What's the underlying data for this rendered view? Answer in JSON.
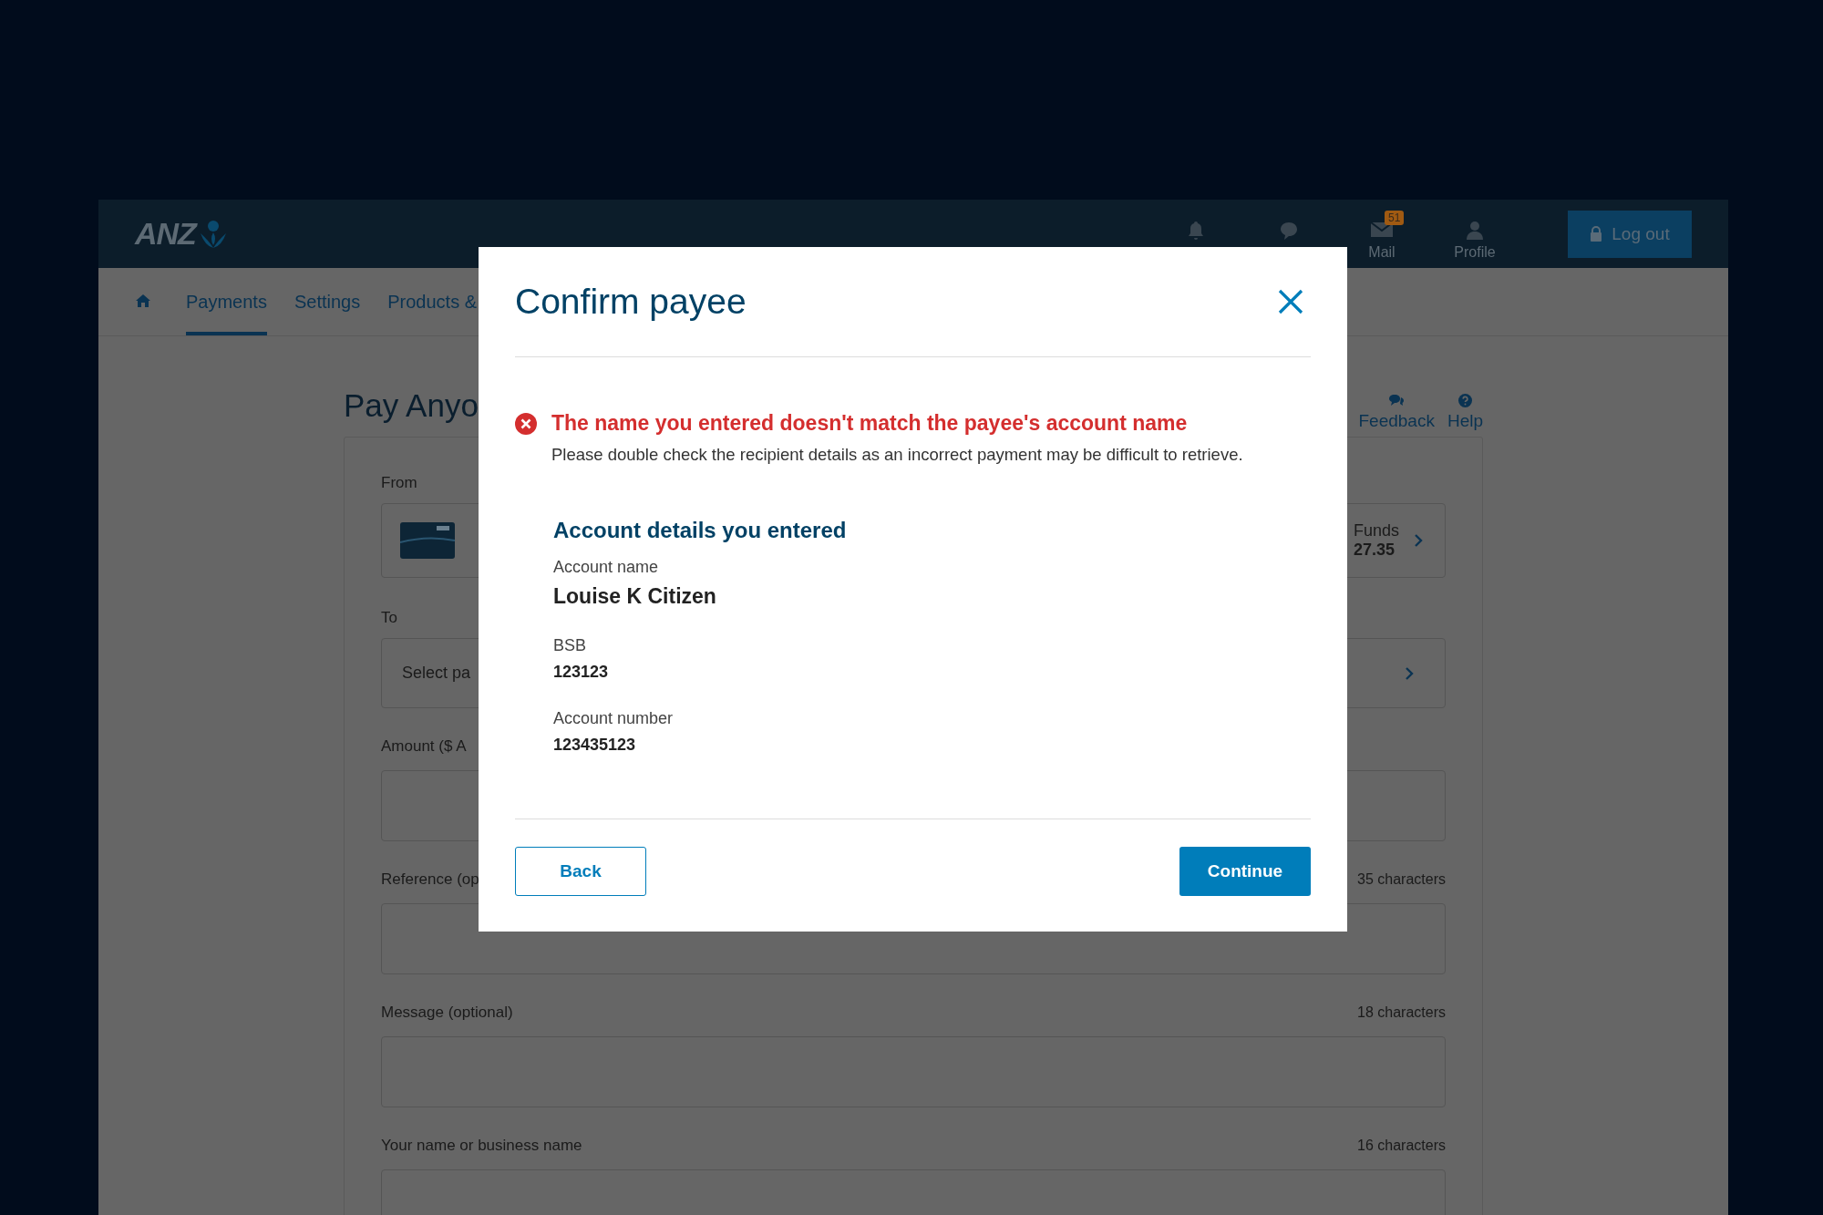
{
  "header": {
    "logo": "ANZ",
    "actions": [
      {
        "kind": "bell"
      },
      {
        "kind": "chat"
      },
      {
        "kind": "mail",
        "label": "Mail",
        "badge": "51"
      },
      {
        "kind": "person",
        "label": "Profile"
      }
    ],
    "logout": "Log out"
  },
  "nav": [
    {
      "kind": "home",
      "selected": false
    },
    {
      "kind": "text",
      "label": "Payments",
      "selected": true
    },
    {
      "kind": "text",
      "label": "Settings",
      "selected": false
    },
    {
      "kind": "text",
      "label": "Products &",
      "selected": false
    }
  ],
  "page": {
    "title": "Pay Anyo",
    "links": [
      {
        "kind": "feedback",
        "label": "Feedback"
      },
      {
        "kind": "help",
        "label": "Help"
      }
    ],
    "from": {
      "label": "From",
      "funds_label": "Funds",
      "funds": "27.35"
    },
    "to": {
      "label": "To",
      "placeholder": "Select pa"
    },
    "fields": [
      {
        "label": "Amount ($ A"
      },
      {
        "label": "Reference (op",
        "count": "35 characters"
      },
      {
        "label": "Message (optional)",
        "count": "18 characters"
      },
      {
        "label": "Your name or business name",
        "count": "16 characters"
      }
    ]
  },
  "modal": {
    "title": "Confirm payee",
    "error": {
      "heading": "The name you entered doesn't match the payee's account name",
      "text": "Please double check the recipient details as an incorrect payment may be difficult to retrieve."
    },
    "section_title": "Account details you entered",
    "details": [
      {
        "label": "Account name",
        "value": "Louise K Citizen",
        "kind": "large"
      },
      {
        "label": "BSB",
        "value": "123123",
        "kind": "normal"
      },
      {
        "label": "Account number",
        "value": "123435123",
        "kind": "normal"
      }
    ],
    "buttons": [
      {
        "label": "Back",
        "kind": "secondary"
      },
      {
        "label": "Continue",
        "kind": "primary"
      }
    ]
  }
}
